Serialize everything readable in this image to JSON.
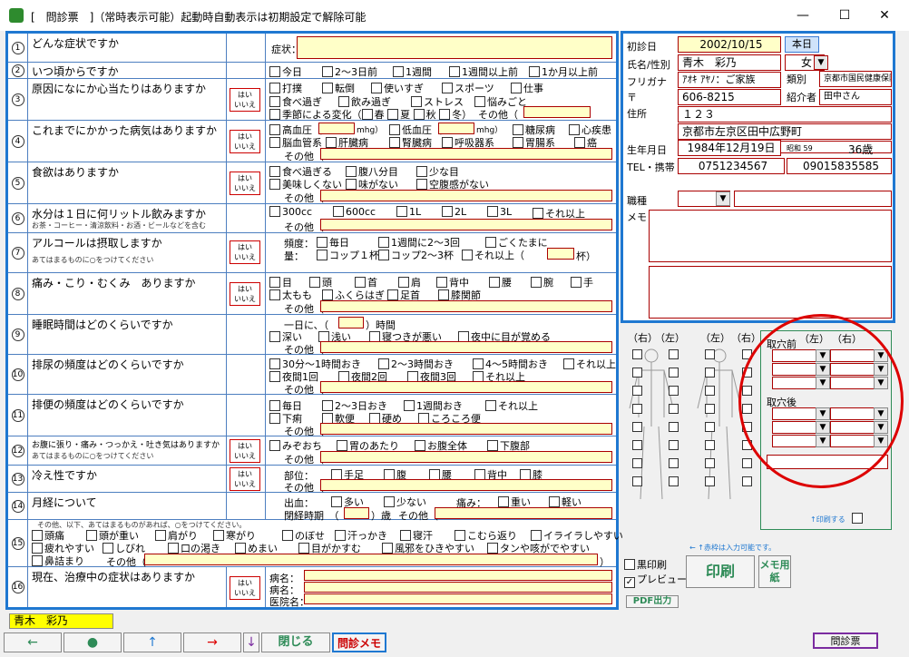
{
  "window": {
    "title": "[　問診票　]（常時表示可能）起動時自動表示は初期設定で解除可能",
    "minimize": "—",
    "maximize": "☐",
    "close": "✕"
  },
  "yn": {
    "yes": "はい",
    "no": "いいえ"
  },
  "q1": {
    "num": "1",
    "text": "どんな症状ですか",
    "label": "症状："
  },
  "q2": {
    "num": "2",
    "text": "いつ頃からですか",
    "opts": [
      "今日",
      "2～3日前",
      "1週間",
      "1週間以上前",
      "1か月以上前"
    ]
  },
  "q3": {
    "num": "3",
    "text": "原因になにか心当たりはありますか",
    "opts": [
      "打撲",
      "転倒",
      "使いすぎ",
      "スポーツ",
      "仕事",
      "食べ過ぎ",
      "飲み過ぎ",
      "ストレス",
      "悩みごと"
    ],
    "season": "季節による変化（",
    "s1": "春",
    "s2": "夏",
    "s3": "秋",
    "s4": "冬",
    "close": "）",
    "other": "その他（",
    "other_close": "）"
  },
  "q4": {
    "num": "4",
    "text": "これまでにかかった病気はありますか",
    "opts": [
      "高血圧（",
      "低血圧（",
      "糖尿病",
      "心疾患",
      "脳血管系",
      "肝臓病",
      "腎臓病",
      "呼吸器系",
      "胃腸系",
      "癌"
    ],
    "unit1": "mhg）",
    "unit2": "mhg）",
    "other": "その他（"
  },
  "q5": {
    "num": "5",
    "text": "食欲はありますか",
    "opts": [
      "食べ過ぎる",
      "腹八分目",
      "少な目",
      "美味しくない",
      "味がない",
      "空腹感がない"
    ],
    "other": "その他（"
  },
  "q6": {
    "num": "6",
    "text": "水分は１日に何リットル飲みますか",
    "sub": "お茶・コーヒー・清涼飲料・お酒・ビールなどを含む",
    "opts": [
      "300cc",
      "600cc",
      "1L",
      "2L",
      "3L",
      "それ以上"
    ],
    "other": "その他（"
  },
  "q7": {
    "num": "7",
    "text": "アルコールは摂取しますか",
    "sub": "あてはまるものに○をつけてください",
    "freq": "頻度：",
    "opts": [
      "毎日",
      "1週間に2～3回",
      "ごくたまに"
    ],
    "amount": "量：",
    "opts2": [
      "コップ１杯",
      "コップ2～3杯",
      "それ以上（"
    ],
    "unit": "杯）"
  },
  "q8": {
    "num": "8",
    "text": "痛み・こり・むくみ　ありますか",
    "opts": [
      "目",
      "頭",
      "首",
      "肩",
      "背中",
      "腰",
      "腕",
      "手",
      "太もも",
      "ふくらはぎ",
      "足首",
      "膝関節"
    ],
    "other": "その他（"
  },
  "q9": {
    "num": "9",
    "text": "睡眠時間はどのくらいですか",
    "pre": "一日に、（",
    "post": "）時間",
    "opts": [
      "深い",
      "浅い",
      "寝つきが悪い",
      "夜中に目が覚める"
    ],
    "other": "その他（"
  },
  "q10": {
    "num": "10",
    "text": "排尿の頻度はどのくらいですか",
    "opts": [
      "30分～1時間おき",
      "2～3時間おき",
      "4～5時間おき",
      "それ以上",
      "夜間1回",
      "夜間2回",
      "夜間3回",
      "それ以上"
    ],
    "other": "その他（"
  },
  "q11": {
    "num": "11",
    "text": "排便の頻度はどのくらいですか",
    "opts": [
      "毎日",
      "2～3日おき",
      "1週間おき",
      "それ以上",
      "下痢",
      "軟便",
      "硬め",
      "ころころ便"
    ],
    "other": "その他（"
  },
  "q12": {
    "num": "12",
    "text": "お腹に張り・痛み・つっかえ・吐き気はありますか",
    "sub": "あてはまるものに○をつけてください",
    "opts": [
      "みぞおち",
      "胃のあたり",
      "お腹全体",
      "下腹部"
    ],
    "other": "その他（"
  },
  "q13": {
    "num": "13",
    "text": "冷え性ですか",
    "part": "部位：",
    "opts": [
      "手足",
      "腹",
      "腰",
      "背中",
      "膝"
    ],
    "other": "その他（"
  },
  "q14": {
    "num": "14",
    "text": "月経について",
    "blood": "出血：",
    "opts": [
      "多い",
      "少ない"
    ],
    "pain": "痛み：",
    "opts2": [
      "重い",
      "軽い"
    ],
    "meno": "閉経時期　（",
    "meno2": "）歳",
    "other": "その他（"
  },
  "q15": {
    "num": "15",
    "sub": "その他、以下、あてはまるものがあれば、○をつけてください。",
    "opts": [
      "頭痛",
      "頭が重い",
      "肩がり",
      "寒がり",
      "のぼせ",
      "汗っかき",
      "寝汗",
      "こむら返り",
      "イライラしやすい",
      "疲れやすい",
      "しびれ",
      "口の渇き",
      "めまい",
      "目がかすむ",
      "風邪をひきやすい",
      "タンや咳がでやすい",
      "鼻詰まり"
    ],
    "other": "その他（",
    "close": "）"
  },
  "q16": {
    "num": "16",
    "text": "現在、治療中の症状はありますか",
    "l1": "病名：",
    "l2": "病名：",
    "l3": "医院名："
  },
  "patient": {
    "first_visit_label": "初診日",
    "first_visit": "2002/10/15",
    "today_btn": "本日",
    "name_label": "氏名/性別",
    "name": "青木　彩乃",
    "sex": "女",
    "kana_label": "フリガナ",
    "kana": "ｱｵｷ ｱﾔﾉ：ご家族",
    "type_label": "類別",
    "type": "京都市国民健康保険",
    "zip_label": "〒",
    "zip": "606-8215",
    "intro_label": "紹介者",
    "intro": "田中さん",
    "addr_label": "住所",
    "addr1": "１２３",
    "addr2": "京都市左京区田中広野町",
    "birth_label": "生年月日",
    "birth": "1984年12月19日",
    "era": "昭和 59",
    "age": "36歳",
    "tel_label": "TEL・携帯",
    "tel": "0751234567",
    "mobile": "09015835585",
    "job_label": "職種",
    "memo_label": "メモ"
  },
  "body": {
    "l1": "（右）",
    "l2": "（左）",
    "l3": "（左）",
    "l4": "（右）",
    "before": "取穴前",
    "after": "取穴後",
    "c1": "（左）",
    "c2": "（右）",
    "print_note": "↑印刷する",
    "note": "← ↑赤枠は入力可能です。"
  },
  "print": {
    "black": "黒印刷",
    "preview": "プレビュー",
    "print_btn": "印刷",
    "memo_btn": "メモ用紙",
    "pdf": "PDF出力"
  },
  "footer": {
    "patient": "青木　彩乃",
    "left": "←",
    "dot": "●",
    "up": "↑",
    "right": "→",
    "down": "↓",
    "close": "閉じる",
    "memo": "問診メモ",
    "sheet": "問診票"
  },
  "colors": {
    "accent": "#1f78d1",
    "yellow": "#ffffc8",
    "red": "#cc0000",
    "green": "#2e8b57"
  }
}
